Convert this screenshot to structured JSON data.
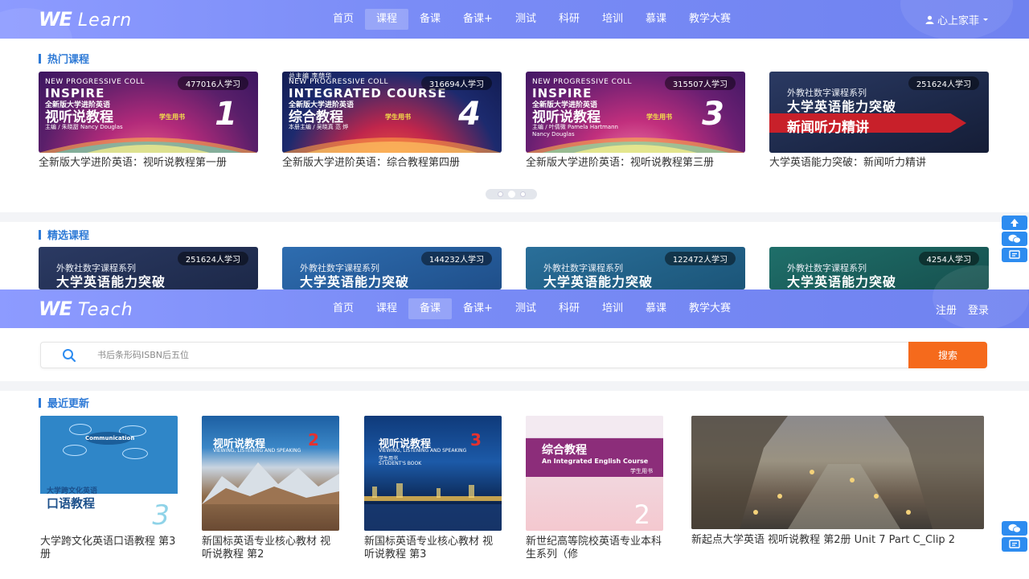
{
  "learn": {
    "brand_we": "WE",
    "brand_sub": "Learn",
    "nav": [
      "首页",
      "课程",
      "备课",
      "备课+",
      "测试",
      "科研",
      "培训",
      "慕课",
      "教学大赛"
    ],
    "active_nav": "课程",
    "user": "心上家菲",
    "hot_section": "热门课程",
    "hot_courses": [
      {
        "count": "477016人学习",
        "title": "全新版大学进阶英语：视听说教程第一册",
        "cover": {
          "l1": "NEW PROGRESSIVE COLL",
          "l2": "INSPIRE",
          "l3": "全新版大学进阶英语",
          "l4": "视听说教程",
          "num": "1",
          "sb": "学生用书",
          "au": "主编 / 朱晓甜 Nancy Douglas"
        }
      },
      {
        "count": "316694人学习",
        "title": "全新版大学进阶英语：综合教程第四册",
        "cover": {
          "top": "总主编  李荫华",
          "l1": "NEW PROGRESSIVE COLL",
          "l2": "INTEGRATED COURSE",
          "l3": "全新版大学进阶英语",
          "l4": "综合教程",
          "num": "4",
          "sb": "学生用书",
          "au": "本册主编 / 吴晓真  范  烨"
        }
      },
      {
        "count": "315507人学习",
        "title": "全新版大学进阶英语：视听说教程第三册",
        "cover": {
          "l1": "NEW PROGRESSIVE COLL",
          "l2": "INSPIRE",
          "l3": "全新版大学进阶英语",
          "l4": "视听说教程",
          "num": "3",
          "sb": "学生用书",
          "au": "主编 / 叶倩微  Pamela Hartmann  Nancy Douglas"
        }
      },
      {
        "count": "251624人学习",
        "title": "大学英语能力突破：新闻听力精讲",
        "cover": {
          "series": "外教社数字课程系列",
          "main": "大学英语能力突破",
          "red": "新闻听力精讲"
        }
      }
    ],
    "featured_section": "精选课程",
    "featured_courses": [
      {
        "count": "251624人学习",
        "series": "外教社数字课程系列",
        "main": "大学英语能力突破"
      },
      {
        "count": "144232人学习",
        "series": "外教社数字课程系列",
        "main": "大学英语能力突破"
      },
      {
        "count": "122472人学习",
        "series": "外教社数字课程系列",
        "main": "大学英语能力突破"
      },
      {
        "count": "4254人学习",
        "series": "外教社数字课程系列",
        "main": "大学英语能力突破"
      }
    ]
  },
  "teach": {
    "brand_we": "WE",
    "brand_sub": "Teach",
    "nav": [
      "首页",
      "课程",
      "备课",
      "备课+",
      "测试",
      "科研",
      "培训",
      "慕课",
      "教学大赛"
    ],
    "active_nav": "备课",
    "register": "注册",
    "login": "登录",
    "search_placeholder": "书后条形码ISBN后五位",
    "search_button": "搜索",
    "recent_section": "最近更新",
    "books": [
      {
        "title": "大学跨文化英语口语教程 第3册",
        "cover": {
          "a": "Communication",
          "b": "大学跨文化英语",
          "c": "口语教程",
          "num": "3"
        }
      },
      {
        "title": "新国标英语专业核心教材 视听说教程 第2",
        "cover": {
          "a": "视听说教程",
          "num": "2",
          "b": "VIEWING, LISTENING AND SPEAKING"
        }
      },
      {
        "title": "新国标英语专业核心教材 视听说教程 第3",
        "cover": {
          "a": "视听说教程",
          "num": "3",
          "b": "VIEWING, LISTENING AND SPEAKING",
          "c": "学生用书",
          "d": "STUDENT'S BOOK"
        }
      },
      {
        "title": "新世纪高等院校英语专业本科生系列（修",
        "cover": {
          "a": "综合教程",
          "b": "An Integrated English Course",
          "c": "学生用书",
          "num": "2"
        }
      },
      {
        "title": "新起点大学英语 视听说教程 第2册 Unit 7 Part C_Clip 2"
      }
    ]
  },
  "colors": {
    "accent": "#2e7ad6",
    "header": "#7a8cf6",
    "search_button": "#f56a1c",
    "float": "#2d8cf0"
  }
}
